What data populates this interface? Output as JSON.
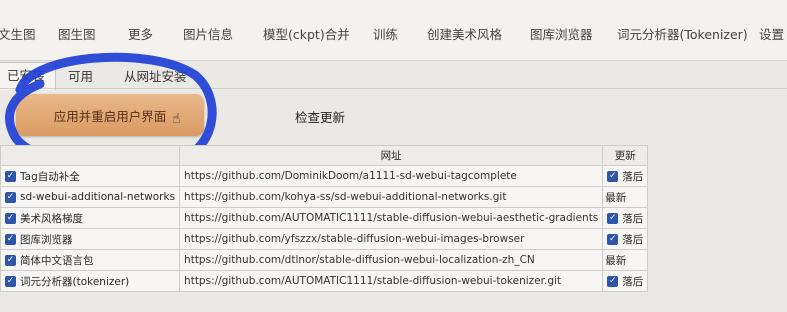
{
  "top_tabs": [
    "文生图",
    "图生图",
    "更多",
    "图片信息",
    "模型(ckpt)合并",
    "训练",
    "创建美术风格",
    "图库浏览器",
    "词元分析器(Tokenizer)",
    "设置"
  ],
  "sub_tabs": [
    "已安装",
    "可用",
    "从网址安装"
  ],
  "buttons": {
    "apply_restart": "应用并重启用户界面",
    "check_updates": "检查更新"
  },
  "table": {
    "headers": [
      "",
      "网址",
      "更新"
    ],
    "rows": [
      {
        "name": "Tag自动补全",
        "url": "https://github.com/DominikDoom/a1111-sd-webui-tagcomplete",
        "update": "落后",
        "update_checkbox": true
      },
      {
        "name": "sd-webui-additional-networks",
        "url": "https://github.com/kohya-ss/sd-webui-additional-networks.git",
        "update": "最新",
        "update_checkbox": false
      },
      {
        "name": "美术风格梯度",
        "url": "https://github.com/AUTOMATIC1111/stable-diffusion-webui-aesthetic-gradients",
        "update": "落后",
        "update_checkbox": true
      },
      {
        "name": "图库浏览器",
        "url": "https://github.com/yfszzx/stable-diffusion-webui-images-browser",
        "update": "落后",
        "update_checkbox": true
      },
      {
        "name": "简体中文语言包",
        "url": "https://github.com/dtlnor/stable-diffusion-webui-localization-zh_CN",
        "update": "最新",
        "update_checkbox": false
      },
      {
        "name": "词元分析器(tokenizer)",
        "url": "https://github.com/AUTOMATIC1111/stable-diffusion-webui-tokenizer.git",
        "update": "落后",
        "update_checkbox": true
      }
    ]
  },
  "colors": {
    "apply_button": "#d99a63",
    "checkbox": "#2d56a8",
    "scribble": "#1f3fd6"
  },
  "icons": {
    "checkbox": "check-icon",
    "cursor": "hand-pointer-icon"
  }
}
